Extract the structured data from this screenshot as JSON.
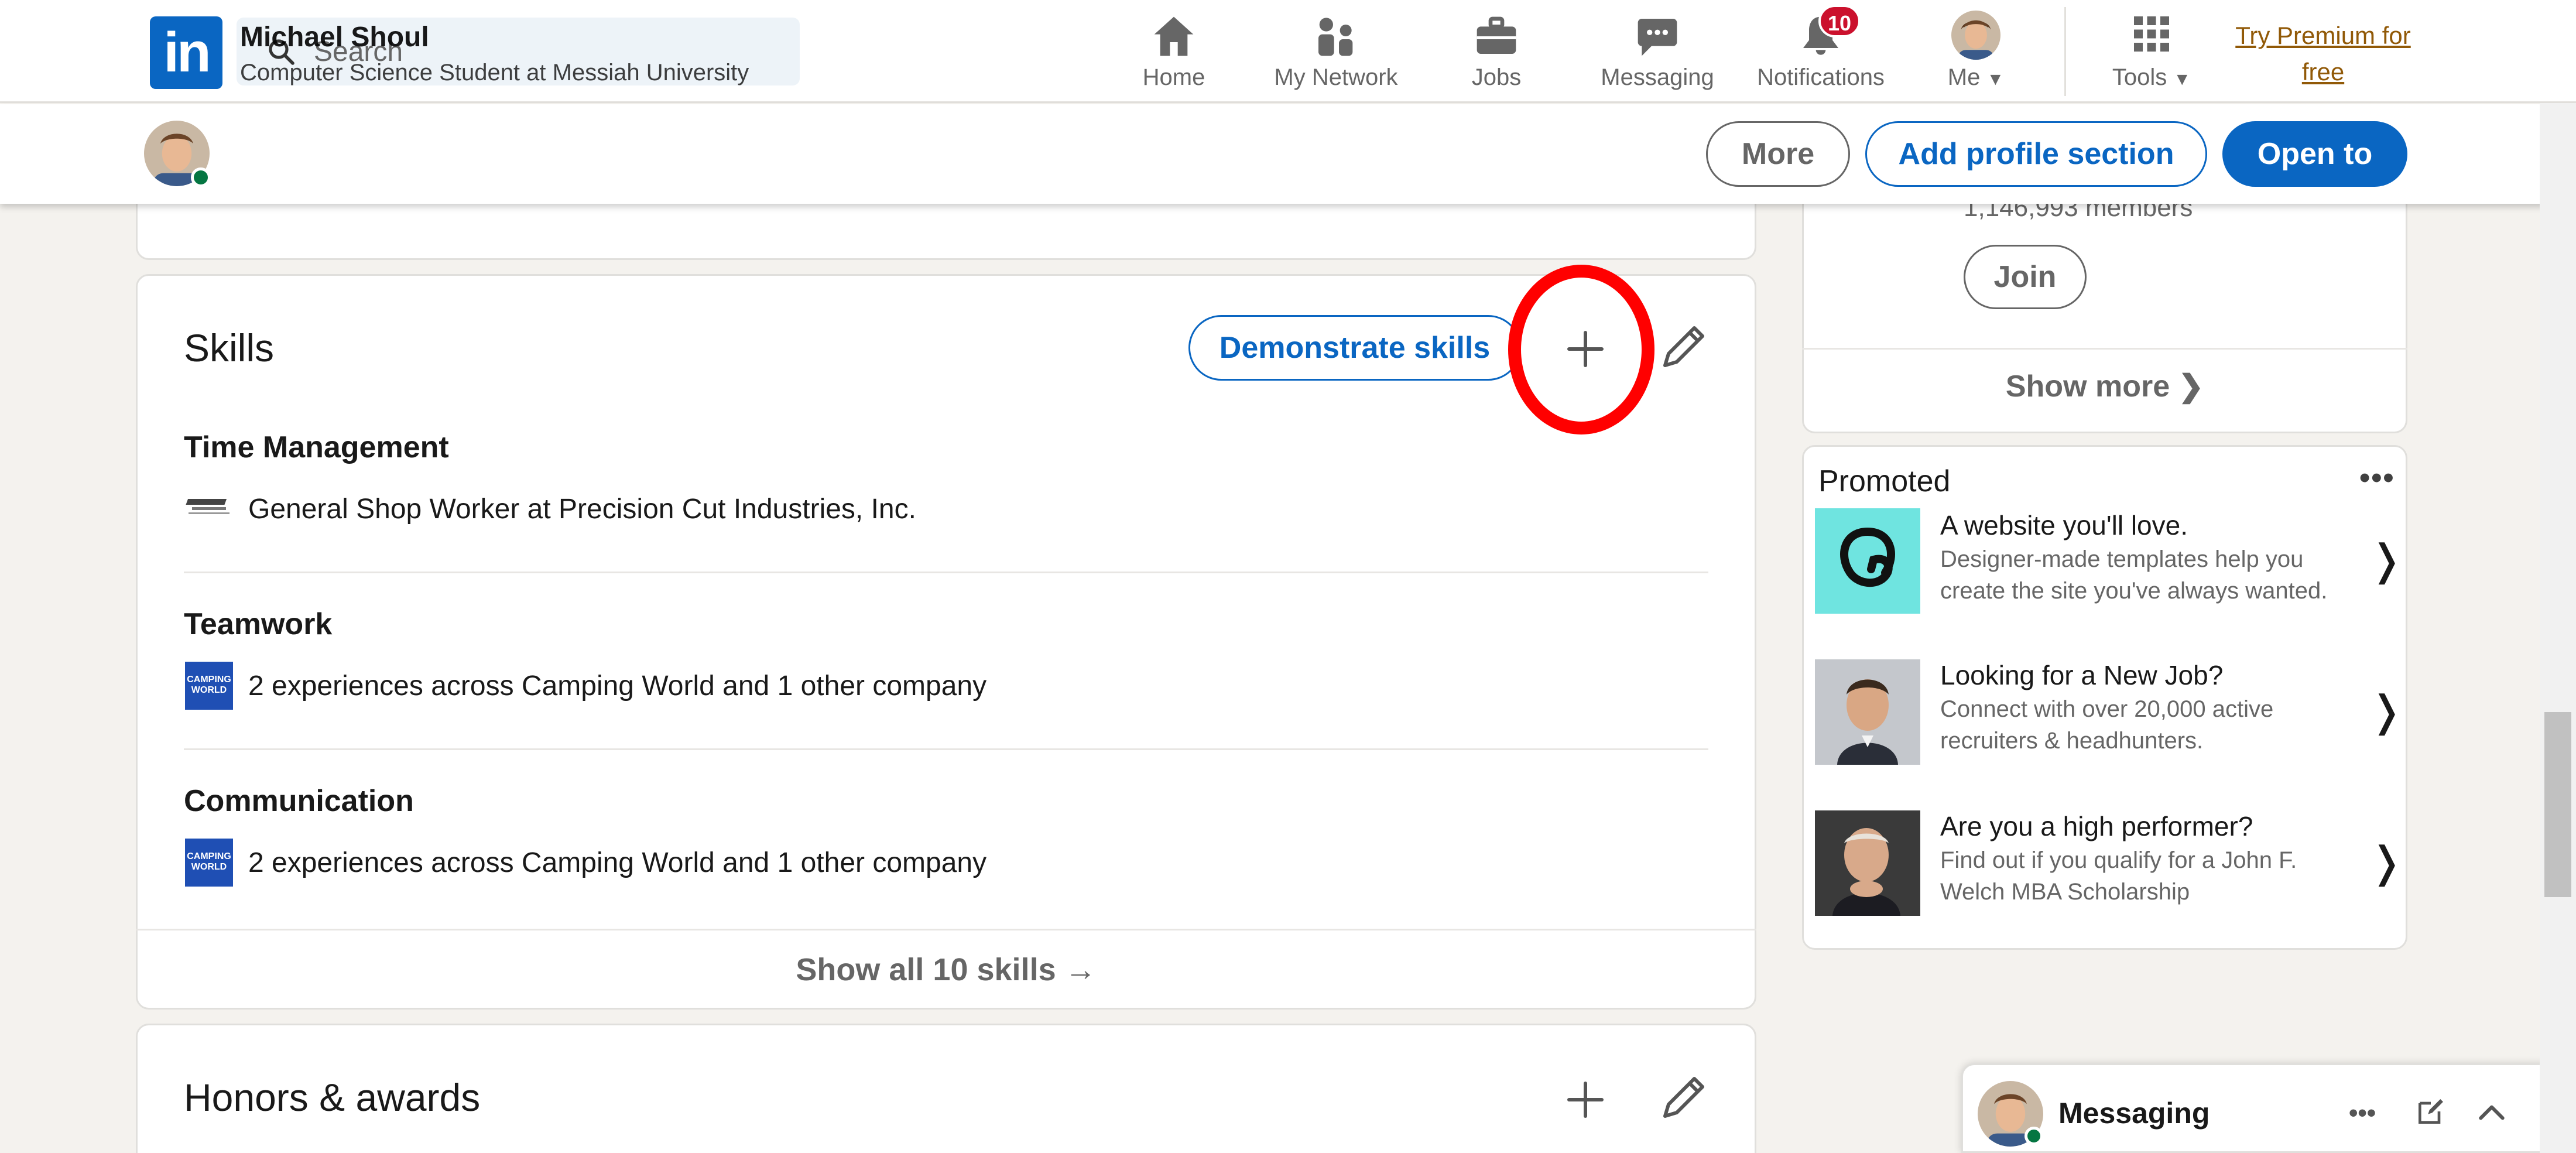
{
  "nav": {
    "logo_text": "in",
    "search_placeholder": "Search",
    "items": [
      {
        "label": "Home",
        "icon": "home-icon"
      },
      {
        "label": "My Network",
        "icon": "people-icon"
      },
      {
        "label": "Jobs",
        "icon": "briefcase-icon"
      },
      {
        "label": "Messaging",
        "icon": "chat-icon"
      },
      {
        "label": "Notifications",
        "icon": "bell-icon",
        "badge": "10"
      },
      {
        "label": "Me",
        "icon": "avatar"
      },
      {
        "label": "Tools",
        "icon": "grid-icon"
      }
    ],
    "premium_line1": "Try Premium for",
    "premium_line2": "free"
  },
  "sticky_bar": {
    "name": "Michael Shoul",
    "headline": "Computer Science Student at Messiah University",
    "more_label": "More",
    "add_section_label": "Add profile section",
    "open_to_label": "Open to"
  },
  "skills": {
    "title": "Skills",
    "demonstrate_label": "Demonstrate skills",
    "items": [
      {
        "name": "Time Management",
        "detail": "General Shop Worker at Precision Cut Industries, Inc."
      },
      {
        "name": "Teamwork",
        "detail": "2 experiences across Camping World and 1 other company"
      },
      {
        "name": "Communication",
        "detail": "2 experiences across Camping World and 1 other company"
      }
    ],
    "show_all_label": "Show all 10 skills →",
    "company_logo_text": "CAMPING WORLD"
  },
  "honors": {
    "title": "Honors & awards"
  },
  "right_rail": {
    "members": "1,146,993 members",
    "join_label": "Join",
    "show_more_label": "Show more ❯",
    "promoted_title": "Promoted",
    "ads": [
      {
        "title": "A website you'll love.",
        "desc": "Designer-made templates help you create the site you've always wanted.",
        "image": "godaddy-logo"
      },
      {
        "title": "Looking for a New Job?",
        "desc": "Connect with over 20,000 active recruiters & headhunters.",
        "image": "man-portrait"
      },
      {
        "title": "Are you a high performer?",
        "desc": "Find out if you qualify for a John F. Welch MBA Scholarship",
        "image": "older-man-portrait"
      }
    ]
  },
  "messaging_overlay": {
    "label": "Messaging"
  },
  "colors": {
    "brand_blue": "#0a66c2",
    "badge_red": "#cb112d",
    "premium_gold": "#915907",
    "annotation_red": "#ff0000",
    "online_green": "#057642"
  }
}
